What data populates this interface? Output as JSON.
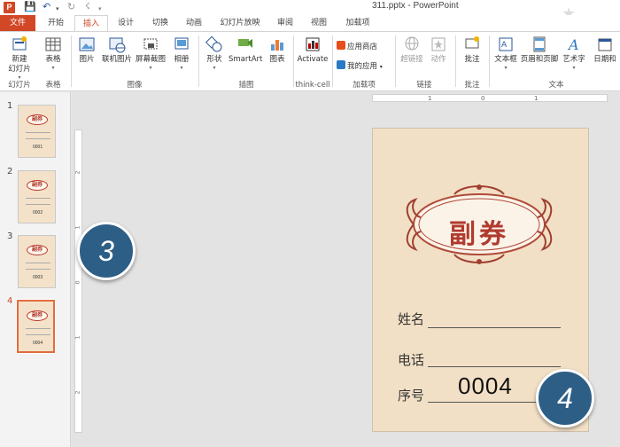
{
  "window": {
    "title": "311.pptx - PowerPoint",
    "app_icon": "P"
  },
  "quick_access": {
    "save": "💾",
    "undo": "↶",
    "undo_dd": "▾",
    "redo": "↻",
    "extra": "☇",
    "extra_dd": "▾"
  },
  "tabs": [
    {
      "label": "文件"
    },
    {
      "label": "开始"
    },
    {
      "label": "插入"
    },
    {
      "label": "设计"
    },
    {
      "label": "切换"
    },
    {
      "label": "动画"
    },
    {
      "label": "幻灯片放映"
    },
    {
      "label": "审阅"
    },
    {
      "label": "视图"
    },
    {
      "label": "加载项"
    }
  ],
  "ribbon": {
    "buttons": {
      "new_slide": "新建\n幻灯片",
      "table": "表格",
      "picture": "图片",
      "online_picture": "联机图片",
      "screenshot": "屏幕截图",
      "album": "相册",
      "shapes": "形状",
      "smartart": "SmartArt",
      "chart": "图表",
      "activate": "Activate",
      "app_store": "应用商店",
      "my_apps": "我的应用",
      "hyperlink": "超链接",
      "action": "动作",
      "comment": "批注",
      "textbox": "文本框",
      "header_footer": "页眉和页脚",
      "wordart": "艺术字",
      "date_time": "日期和"
    },
    "groups": {
      "slides": "幻灯片",
      "tables": "表格",
      "images": "图像",
      "illustrations": "插图",
      "thinkcell": "think-cell",
      "addins": "加载项",
      "links": "链接",
      "comments": "批注",
      "text": "文本"
    }
  },
  "thumbnails": [
    {
      "num": "1",
      "serial": "0001",
      "title": "副券"
    },
    {
      "num": "2",
      "serial": "0002",
      "title": "副券"
    },
    {
      "num": "3",
      "serial": "0003",
      "title": "副券"
    },
    {
      "num": "4",
      "serial": "0004",
      "title": "副券"
    }
  ],
  "rulers": {
    "horizontal": [
      "1",
      "0",
      "1"
    ],
    "vertical": [
      "2",
      "1",
      "0",
      "1",
      "2"
    ]
  },
  "slide": {
    "title": "副券",
    "fields": {
      "name": "姓名",
      "phone": "电话",
      "serial_label": "序号"
    },
    "serial": "0004"
  },
  "badges": {
    "left": "3",
    "right": "4"
  },
  "colors": {
    "accent": "#d24726",
    "badge": "#2d5e86",
    "ticket_bg": "#f2e0c6",
    "emblem_red": "#b03a2e"
  }
}
